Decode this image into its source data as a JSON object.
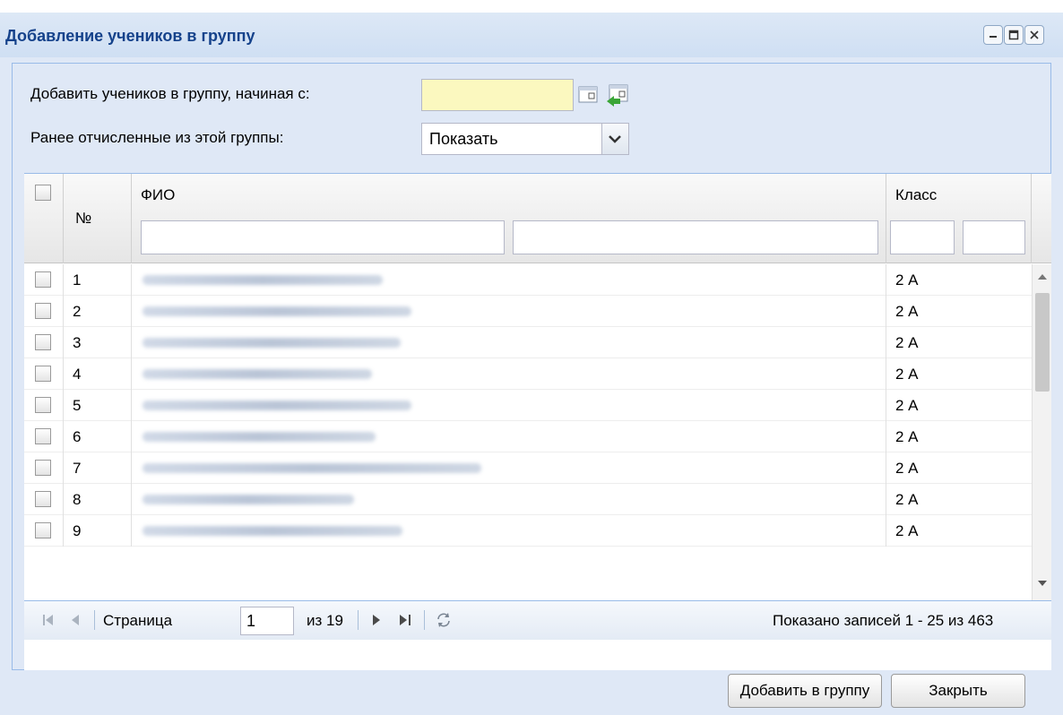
{
  "window": {
    "title": "Добавление учеников в группу",
    "tools": [
      "minimize-icon",
      "maximize-icon",
      "close-icon"
    ]
  },
  "form": {
    "start_date_label": "Добавить учеников в группу, начиная с:",
    "start_date_value": "",
    "expelled_label": "Ранее отчисленные из этой группы:",
    "expelled_value": "Показать"
  },
  "grid": {
    "columns": {
      "number": "№",
      "fio": "ФИО",
      "class": "Класс"
    },
    "rows": [
      {
        "num": "1",
        "class": "2 А"
      },
      {
        "num": "2",
        "class": "2 А"
      },
      {
        "num": "3",
        "class": "2 А"
      },
      {
        "num": "4",
        "class": "2 А"
      },
      {
        "num": "5",
        "class": "2 А"
      },
      {
        "num": "6",
        "class": "2 А"
      },
      {
        "num": "7",
        "class": "2 А"
      },
      {
        "num": "8",
        "class": "2 А"
      },
      {
        "num": "9",
        "class": "2 А"
      }
    ]
  },
  "pager": {
    "page_label": "Страница",
    "page_value": "1",
    "of_label": "из 19",
    "summary": "Показано записей 1 - 25 из 463"
  },
  "buttons": {
    "add": "Добавить в группу",
    "close": "Закрыть"
  }
}
